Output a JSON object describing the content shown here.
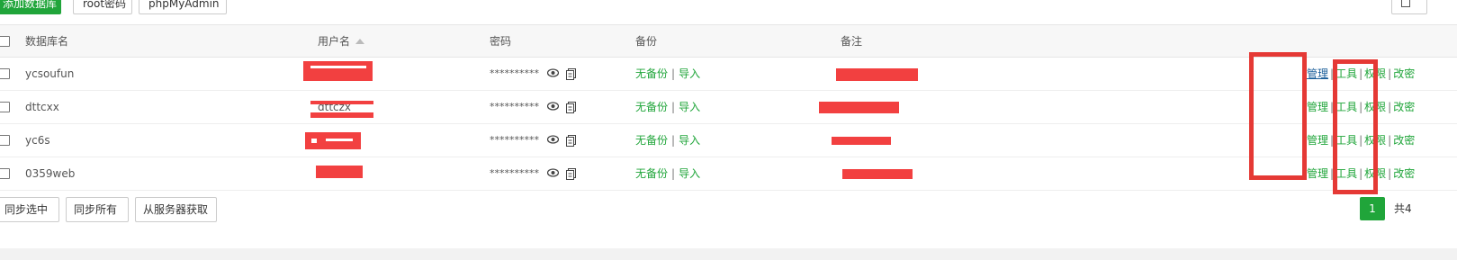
{
  "toolbar": {
    "add_db": "添加数据库",
    "root_pwd": "root密码",
    "phpmyadmin": "phpMyAdmin",
    "recycle_icon": "trash-icon"
  },
  "table": {
    "headers": {
      "name": "数据库名",
      "user": "用户名",
      "password": "密码",
      "backup": "备份",
      "note": "备注"
    },
    "rows": [
      {
        "name": "ycsoufun",
        "user": "",
        "password": "**********",
        "backup_status": "无备份",
        "import": "导入",
        "note": ""
      },
      {
        "name": "dttcxx",
        "user": "dttczx",
        "password": "**********",
        "backup_status": "无备份",
        "import": "导入",
        "note": ""
      },
      {
        "name": "yc6s",
        "user": "",
        "password": "**********",
        "backup_status": "无备份",
        "import": "导入",
        "note": ""
      },
      {
        "name": "0359web",
        "user": "",
        "password": "**********",
        "backup_status": "无备份",
        "import": "导入",
        "note": ""
      }
    ],
    "ops": {
      "manage": "管理",
      "tools": "工具",
      "perm": "权限",
      "change": "改密"
    }
  },
  "bottom": {
    "sync_selected": "同步选中",
    "sync_all": "同步所有",
    "fetch_server": "从服务器获取",
    "page": "1",
    "total": "共4"
  },
  "colors": {
    "accent": "#20a53a",
    "redact": "#f24040",
    "annotation": "#e53935"
  }
}
